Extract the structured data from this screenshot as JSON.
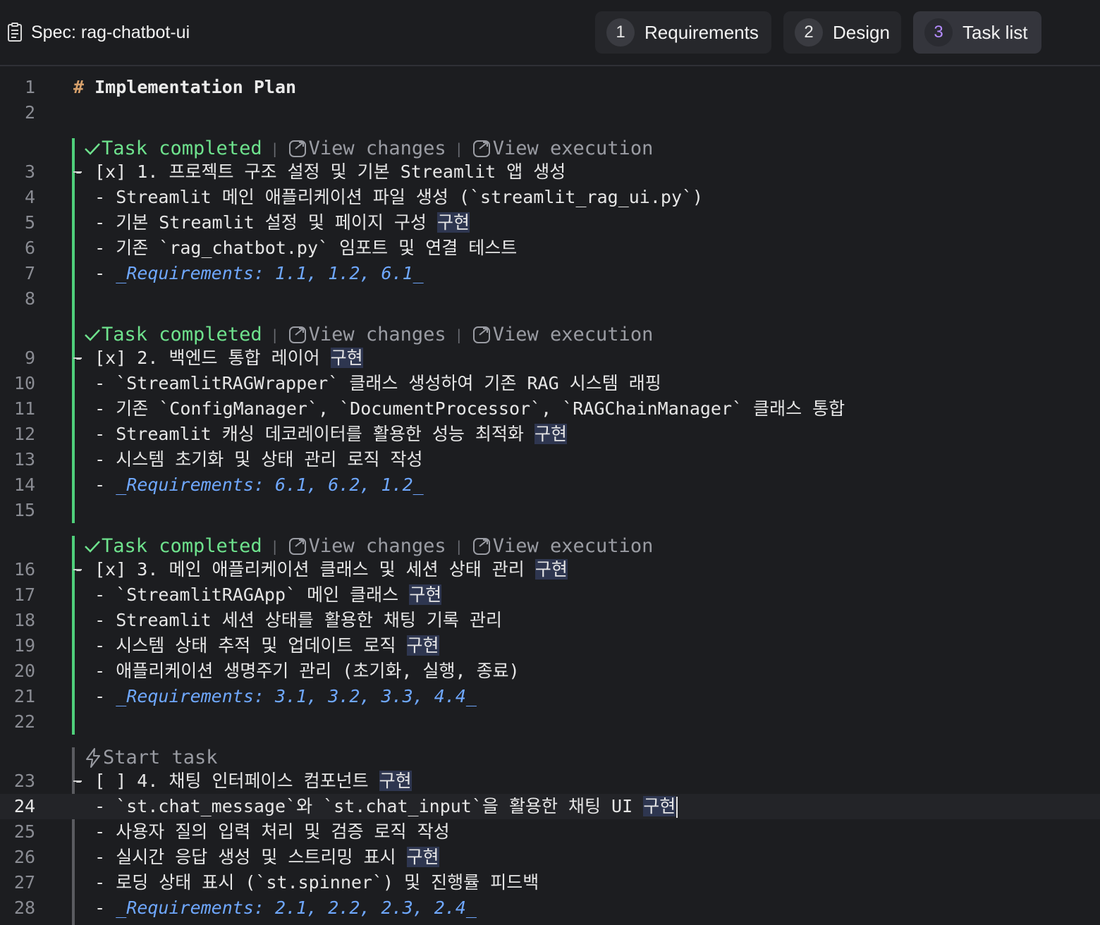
{
  "header": {
    "title": "Spec: rag-chatbot-ui",
    "tabs": [
      {
        "num": "1",
        "label": "Requirements"
      },
      {
        "num": "2",
        "label": "Design"
      },
      {
        "num": "3",
        "label": "Task list"
      }
    ]
  },
  "codelens": {
    "completed": "Task completed",
    "sep": "|",
    "view_changes": "View changes",
    "view_execution": "View execution",
    "start": "Start task"
  },
  "lines": [
    {
      "n": "1",
      "text": "# Implementation Plan"
    },
    {
      "n": "2",
      "text": ""
    },
    {
      "n": "3",
      "text": "- [x] 1. 프로젝트 구조 설정 및 기본 Streamlit 앱 생성"
    },
    {
      "n": "4",
      "text": "  - Streamlit 메인 애플리케이션 파일 생성 (`streamlit_rag_ui.py`)"
    },
    {
      "n": "5",
      "pre": "  - 기본 Streamlit 설정 및 페이지 구성 ",
      "hl": "구현"
    },
    {
      "n": "6",
      "text": "  - 기존 `rag_chatbot.py` 임포트 및 연결 테스트"
    },
    {
      "n": "7",
      "pre": "  - ",
      "req": "_Requirements: 1.1, 1.2, 6.1_"
    },
    {
      "n": "8",
      "text": ""
    },
    {
      "n": "9",
      "pre": "- [x] 2. 백엔드 통합 레이어 ",
      "hl": "구현"
    },
    {
      "n": "10",
      "text": "  - `StreamlitRAGWrapper` 클래스 생성하여 기존 RAG 시스템 래핑"
    },
    {
      "n": "11",
      "text": "  - 기존 `ConfigManager`, `DocumentProcessor`, `RAGChainManager` 클래스 통합"
    },
    {
      "n": "12",
      "pre": "  - Streamlit 캐싱 데코레이터를 활용한 성능 최적화 ",
      "hl": "구현"
    },
    {
      "n": "13",
      "text": "  - 시스템 초기화 및 상태 관리 로직 작성"
    },
    {
      "n": "14",
      "pre": "  - ",
      "req": "_Requirements: 6.1, 6.2, 1.2_"
    },
    {
      "n": "15",
      "text": ""
    },
    {
      "n": "16",
      "pre": "- [x] 3. 메인 애플리케이션 클래스 및 세션 상태 관리 ",
      "hl": "구현"
    },
    {
      "n": "17",
      "pre": "  - `StreamlitRAGApp` 메인 클래스 ",
      "hl": "구현"
    },
    {
      "n": "18",
      "text": "  - Streamlit 세션 상태를 활용한 채팅 기록 관리"
    },
    {
      "n": "19",
      "pre": "  - 시스템 상태 추적 및 업데이트 로직 ",
      "hl": "구현"
    },
    {
      "n": "20",
      "text": "  - 애플리케이션 생명주기 관리 (초기화, 실행, 종료)"
    },
    {
      "n": "21",
      "pre": "  - ",
      "req": "_Requirements: 3.1, 3.2, 3.3, 4.4_"
    },
    {
      "n": "22",
      "text": ""
    },
    {
      "n": "23",
      "pre": "- [ ] 4. 채팅 인터페이스 컴포넌트 ",
      "hl": "구현"
    },
    {
      "n": "24",
      "pre": "  - `st.chat_message`와 `st.chat_input`을 활용한 채팅 UI ",
      "hl": "구현"
    },
    {
      "n": "25",
      "text": "  - 사용자 질의 입력 처리 및 검증 로직 작성"
    },
    {
      "n": "26",
      "pre": "  - 실시간 응답 생성 및 스트리밍 표시 ",
      "hl": "구현"
    },
    {
      "n": "27",
      "text": "  - 로딩 상태 표시 (`st.spinner`) 및 진행률 피드백"
    },
    {
      "n": "28",
      "pre": "  - ",
      "req": "_Requirements: 2.1, 2.2, 2.3, 2.4_"
    }
  ]
}
